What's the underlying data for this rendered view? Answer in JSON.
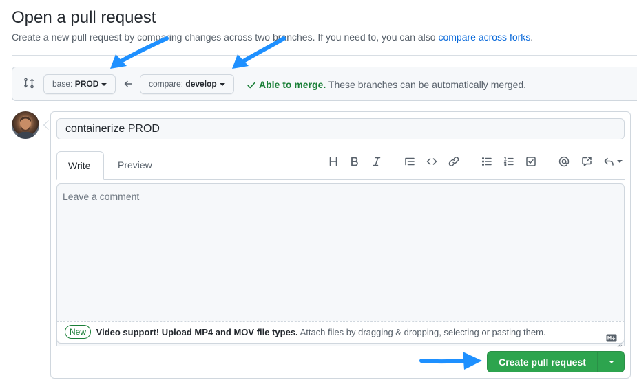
{
  "header": {
    "title": "Open a pull request",
    "description": "Create a new pull request by comparing changes across two branches. If you need to, you can also",
    "forks_link": "compare across forks",
    "period": "."
  },
  "range": {
    "base_prefix": "base:",
    "base_value": "PROD",
    "compare_prefix": "compare:",
    "compare_value": "develop",
    "merge_ok": "Able to merge.",
    "merge_note": "These branches can be automatically merged."
  },
  "composer": {
    "title_value": "containerize PROD",
    "tabs": [
      {
        "label": "Write"
      },
      {
        "label": "Preview"
      }
    ],
    "toolbar_icons": [
      "heading-icon",
      "bold-icon",
      "italic-icon",
      "quote-icon",
      "code-icon",
      "link-icon",
      "bullet-list-icon",
      "numbered-list-icon",
      "task-list-icon",
      "mention-icon",
      "cross-reference-icon",
      "reply-icon"
    ],
    "comment_placeholder": "Leave a comment",
    "upload": {
      "badge": "New",
      "strong": "Video support! Upload MP4 and MOV file types.",
      "text": "Attach files by dragging & dropping, selecting or pasting them."
    },
    "submit_label": "Create pull request"
  },
  "colors": {
    "accent_green": "#2da44e",
    "merge_green": "#1a7f37",
    "link_blue": "#0969da",
    "callout_blue": "#1e90ff"
  }
}
